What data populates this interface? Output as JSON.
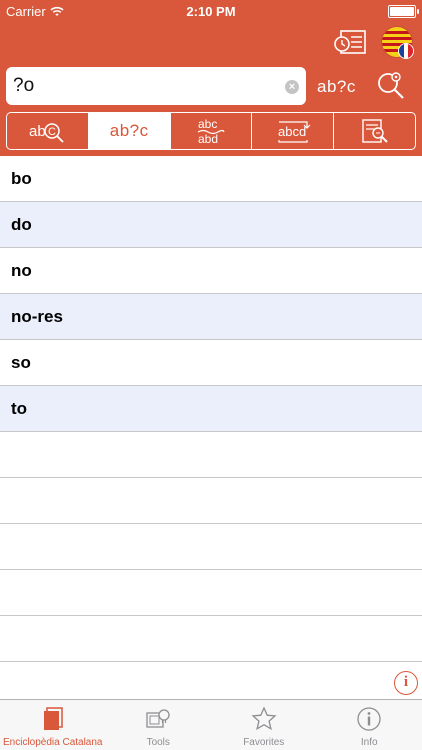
{
  "status_bar": {
    "carrier": "Carrier",
    "time": "2:10 PM"
  },
  "header": {
    "history_icon": "history-list-icon",
    "language_flag": "catalan-french-flag-icon"
  },
  "search": {
    "value": "?o",
    "placeholder": "",
    "mode_label": "ab?c",
    "options_icon": "search-options-icon"
  },
  "segments": [
    {
      "icon": "spell-check-icon",
      "label": "",
      "active": false
    },
    {
      "icon": "wildcard-icon",
      "label": "ab?c",
      "active": true
    },
    {
      "icon": "anagram-icon",
      "label": "",
      "active": false
    },
    {
      "icon": "rhyme-icon",
      "label": "",
      "active": false
    },
    {
      "icon": "fulltext-icon",
      "label": "",
      "active": false
    }
  ],
  "results": [
    "bo",
    "do",
    "no",
    "no-res",
    "so",
    "to"
  ],
  "info_icon": "info-icon",
  "tabs": [
    {
      "label": "Enciclopèdia Catalana",
      "icon": "book-icon",
      "active": true
    },
    {
      "label": "Tools",
      "icon": "tools-icon",
      "active": false
    },
    {
      "label": "Favorites",
      "icon": "star-icon",
      "active": false
    },
    {
      "label": "Info",
      "icon": "info-circle-icon",
      "active": false
    }
  ],
  "colors": {
    "accent": "#d9573a",
    "row_alt": "#ebeefb",
    "tab_inactive": "#8e8e93"
  }
}
